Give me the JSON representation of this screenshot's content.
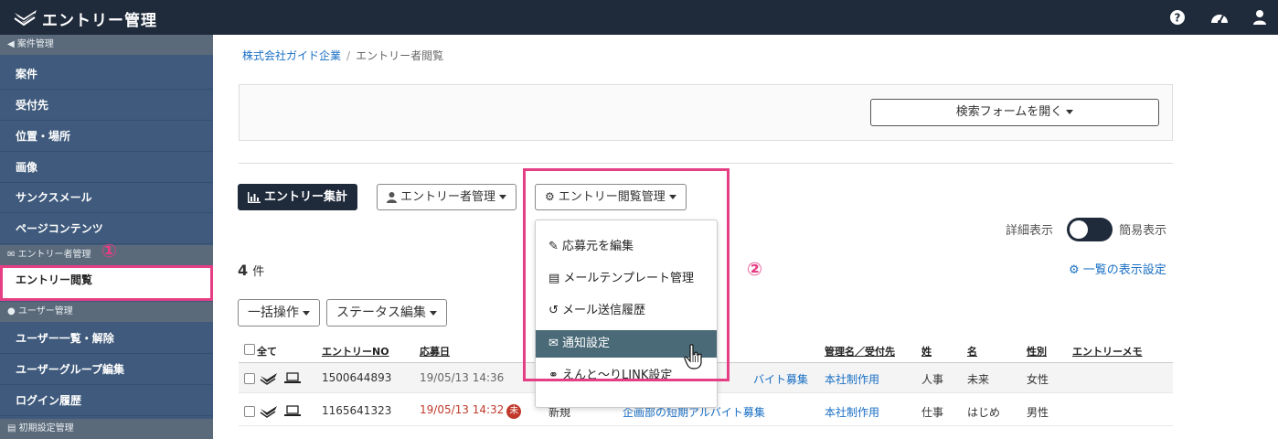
{
  "app": {
    "title": "エントリー管理"
  },
  "topbar": {
    "icons": [
      "help-icon",
      "dashboard-icon",
      "user-icon"
    ]
  },
  "sidebar": {
    "sections": [
      {
        "head": "案件管理",
        "items": [
          "案件",
          "受付先",
          "位置・場所",
          "画像",
          "サンクスメール",
          "ページコンテンツ"
        ]
      },
      {
        "head": "エントリー者管理",
        "items": [
          "エントリー閲覧"
        ]
      },
      {
        "head": "ユーザー管理",
        "items": [
          "ユーザー一覧・解除",
          "ユーザーグループ編集",
          "ログイン履歴"
        ]
      },
      {
        "head": "初期設定管理",
        "items": []
      }
    ]
  },
  "annotations": {
    "mark1": "①",
    "mark2": "②"
  },
  "breadcrumb": {
    "company": "株式会社ガイド企業",
    "current": "エントリー者閲覧"
  },
  "search": {
    "button": "検索フォームを開く"
  },
  "toolbar": {
    "stats": "エントリー集計",
    "entrant_mgmt": "エントリー者管理",
    "view_mgmt": "エントリー閲覧管理"
  },
  "dropdown": {
    "items": [
      "応募元を編集",
      "メールテンプレート管理",
      "メール送信履歴",
      "通知設定",
      "えんと〜りLINK設定"
    ],
    "selected_index": 3
  },
  "display_toggle": {
    "left": "詳細表示",
    "right": "簡易表示"
  },
  "result": {
    "count": "4",
    "unit": "件",
    "list_settings": "一覧の表示設定"
  },
  "bulk": {
    "bulk_ops": "一括操作",
    "status_edit": "ステータス編集"
  },
  "table": {
    "headers": [
      "全て",
      "エントリーNO",
      "応募日",
      "管理名／受付先",
      "姓",
      "名",
      "性別",
      "エントリーメモ"
    ],
    "rows": [
      {
        "no": "1500644893",
        "date": "19/05/13 14:36",
        "status": "",
        "job": "バイト募集",
        "branch": "本社制作用",
        "last": "人事",
        "first": "未来",
        "gender": "女性"
      },
      {
        "no": "1165641323",
        "date": "19/05/13 14:32",
        "badge": "未",
        "status": "新規",
        "job": "企画部の短期アルバイト募集",
        "branch": "本社制作用",
        "last": "仕事",
        "first": "はじめ",
        "gender": "男性"
      }
    ]
  },
  "colors": {
    "topbar": "#1f2a3a",
    "sidebar": "#3f5a7c",
    "highlight": "#e53e84",
    "link": "#1a6fc4",
    "selected": "#4a6a78"
  }
}
